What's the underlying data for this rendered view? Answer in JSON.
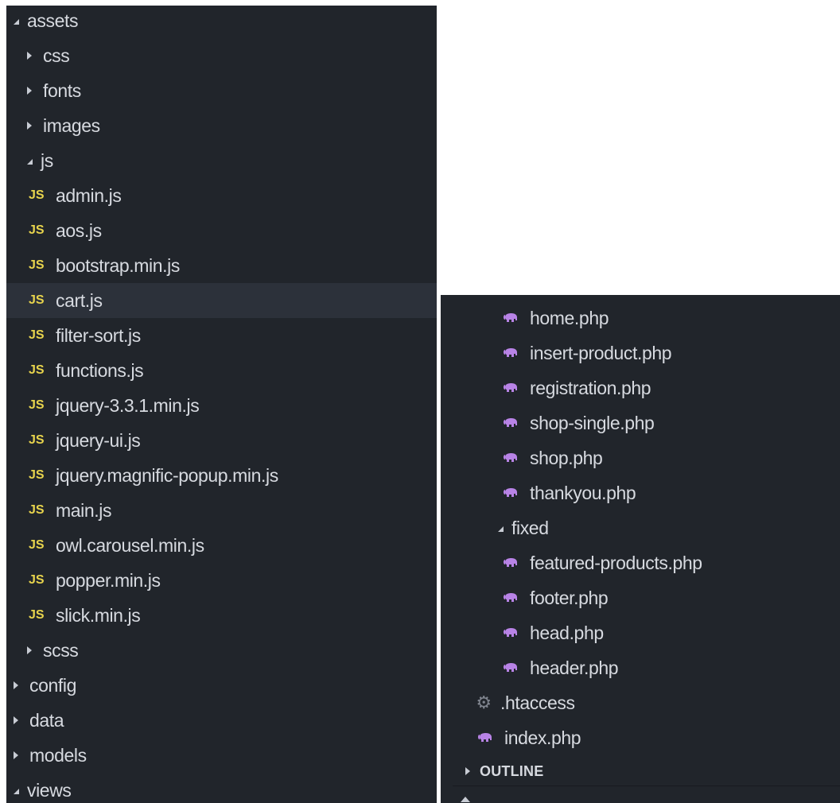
{
  "left_tree": [
    {
      "label": "assets",
      "type": "folder",
      "open": true,
      "level": 0
    },
    {
      "label": "css",
      "type": "folder",
      "open": false,
      "level": 1
    },
    {
      "label": "fonts",
      "type": "folder",
      "open": false,
      "level": 1
    },
    {
      "label": "images",
      "type": "folder",
      "open": false,
      "level": 1
    },
    {
      "label": "js",
      "type": "folder",
      "open": true,
      "level": 1
    },
    {
      "label": "admin.js",
      "type": "js",
      "level": 2
    },
    {
      "label": "aos.js",
      "type": "js",
      "level": 2
    },
    {
      "label": "bootstrap.min.js",
      "type": "js",
      "level": 2
    },
    {
      "label": "cart.js",
      "type": "js",
      "level": 2,
      "selected": true
    },
    {
      "label": "filter-sort.js",
      "type": "js",
      "level": 2
    },
    {
      "label": "functions.js",
      "type": "js",
      "level": 2
    },
    {
      "label": "jquery-3.3.1.min.js",
      "type": "js",
      "level": 2
    },
    {
      "label": "jquery-ui.js",
      "type": "js",
      "level": 2
    },
    {
      "label": "jquery.magnific-popup.min.js",
      "type": "js",
      "level": 2
    },
    {
      "label": "main.js",
      "type": "js",
      "level": 2
    },
    {
      "label": "owl.carousel.min.js",
      "type": "js",
      "level": 2
    },
    {
      "label": "popper.min.js",
      "type": "js",
      "level": 2
    },
    {
      "label": "slick.min.js",
      "type": "js",
      "level": 2
    },
    {
      "label": "scss",
      "type": "folder",
      "open": false,
      "level": 1
    },
    {
      "label": "config",
      "type": "folder",
      "open": false,
      "level": 0
    },
    {
      "label": "data",
      "type": "folder",
      "open": false,
      "level": 0
    },
    {
      "label": "models",
      "type": "folder",
      "open": false,
      "level": 0
    },
    {
      "label": "views",
      "type": "folder",
      "open": true,
      "level": 0
    }
  ],
  "right_tree": [
    {
      "label": "home.php",
      "type": "php",
      "level": 3
    },
    {
      "label": "insert-product.php",
      "type": "php",
      "level": 3
    },
    {
      "label": "registration.php",
      "type": "php",
      "level": 3
    },
    {
      "label": "shop-single.php",
      "type": "php",
      "level": 3
    },
    {
      "label": "shop.php",
      "type": "php",
      "level": 3
    },
    {
      "label": "thankyou.php",
      "type": "php",
      "level": 3
    },
    {
      "label": "fixed",
      "type": "folder",
      "open": true,
      "level": 2
    },
    {
      "label": "featured-products.php",
      "type": "php",
      "level": 3
    },
    {
      "label": "footer.php",
      "type": "php",
      "level": 3
    },
    {
      "label": "head.php",
      "type": "php",
      "level": 3
    },
    {
      "label": "header.php",
      "type": "php",
      "level": 3
    },
    {
      "label": ".htaccess",
      "type": "config",
      "level": 1
    },
    {
      "label": "index.php",
      "type": "php",
      "level": 1
    }
  ],
  "icons": {
    "js": "JS",
    "php": "php-elephant-icon",
    "config": "gear-icon"
  },
  "colors": {
    "panel_bg": "#21252b",
    "selected_bg": "#2c313a",
    "text": "#d7dae0",
    "js_icon": "#e8d44d",
    "php_icon": "#b883e6",
    "gear_icon": "#7f848e"
  },
  "outline": {
    "label": "OUTLINE"
  }
}
